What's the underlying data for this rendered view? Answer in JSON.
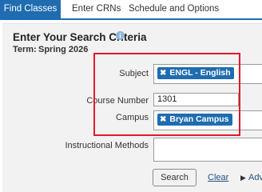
{
  "tabs": [
    {
      "label": "Find Classes",
      "active": true
    },
    {
      "label": "Enter CRNs",
      "active": false
    },
    {
      "label": "Schedule and Options",
      "active": false
    }
  ],
  "search": {
    "heading": "Enter Your Search Criteria",
    "term_label": "Term:",
    "term_value": "Spring 2026"
  },
  "fields": {
    "subject_label": "Subject",
    "subject_chip": "ENGL - English",
    "course_label": "Course Number",
    "course_value": "1301",
    "campus_label": "Campus",
    "campus_chip": "Bryan Campus",
    "methods_label": "Instructional Methods"
  },
  "actions": {
    "search_label": "Search",
    "clear_label": "Clear",
    "advanced_label": "Adva"
  },
  "colors": {
    "accent": "#1f6cb0",
    "highlight": "#e0192b"
  }
}
